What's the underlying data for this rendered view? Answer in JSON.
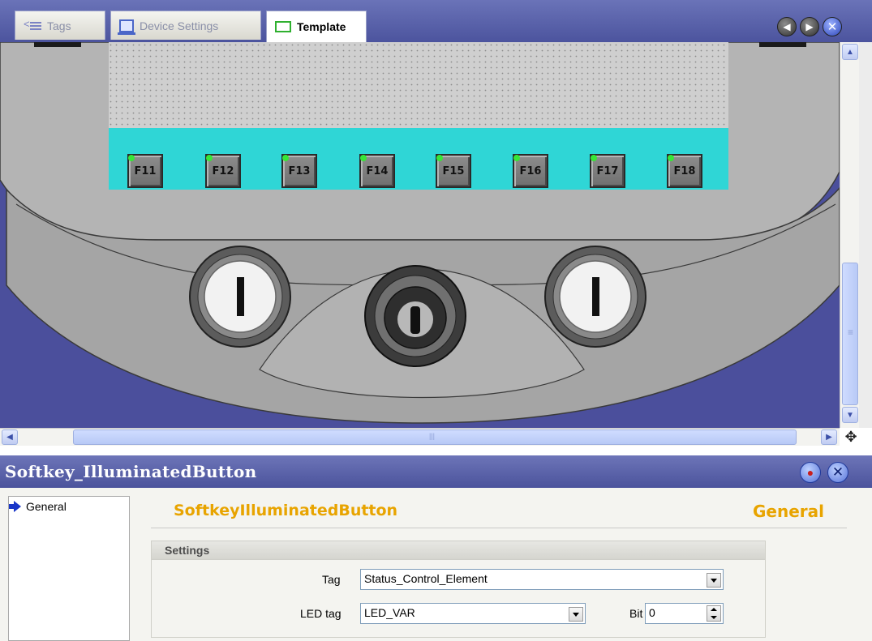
{
  "tabs": [
    {
      "label": "Tags",
      "icon": "tags-icon",
      "active": false
    },
    {
      "label": "Device Settings",
      "icon": "device-settings-icon",
      "active": false
    },
    {
      "label": "Template",
      "icon": "template-icon",
      "active": true
    }
  ],
  "tab_nav": {
    "prev": "◀",
    "next": "▶",
    "close": "✕"
  },
  "softkeys": [
    "F11",
    "F12",
    "F13",
    "F14",
    "F15",
    "F16",
    "F17",
    "F18"
  ],
  "panel": {
    "title": "Softkey_IlluminatedButton",
    "pin_glyph": "📍",
    "close_glyph": "✕",
    "nav_items": [
      "General"
    ],
    "section_title": "SoftkeyIlluminatedButton",
    "section_category": "General",
    "group_title": "Settings",
    "fields": {
      "tag_label": "Tag",
      "tag_value": "Status_Control_Element",
      "led_tag_label": "LED tag",
      "led_tag_value": "LED_VAR",
      "bit_label": "Bit",
      "bit_value": "0"
    }
  },
  "colors": {
    "accent_orange": "#e8a400",
    "title_bar": "#5a62a8",
    "canvas_bg": "#4b4f9c",
    "screen_cyan": "#2fd6d6",
    "led_green": "#37e637"
  }
}
